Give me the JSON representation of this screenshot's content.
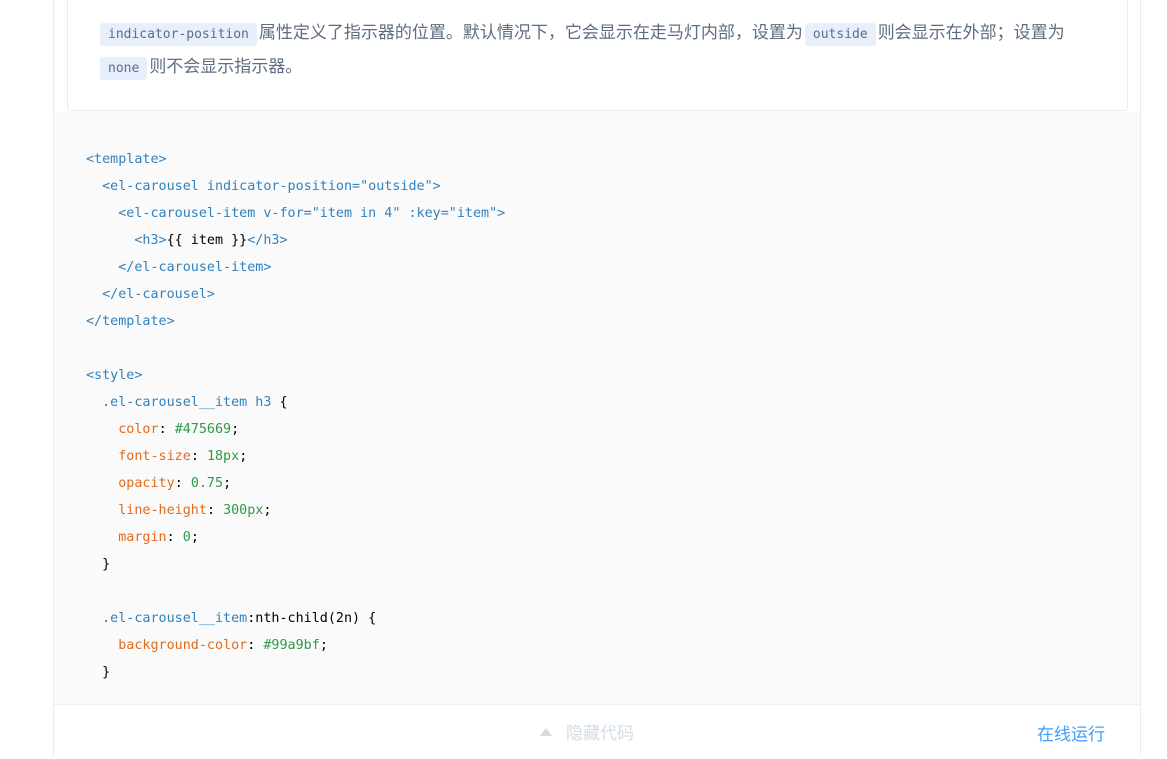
{
  "description": {
    "code_position": "indicator-position",
    "text_1": "属性定义了指示器的位置。默认情况下，它会显示在走马灯内部，设置为",
    "code_outside": "outside",
    "text_2": "则会显示在外部；设置为",
    "code_none": "none",
    "text_3": "则不会显示指示器。"
  },
  "code": {
    "lines": [
      "<template>",
      "  <el-carousel indicator-position=\"outside\">",
      "    <el-carousel-item v-for=\"item in 4\" :key=\"item\">",
      "      <h3>{{ item }}</h3>",
      "    </el-carousel-item>",
      "  </el-carousel>",
      "</template>",
      "",
      "<style>",
      "  .el-carousel__item h3 {",
      "    color: #475669;",
      "    font-size: 18px;",
      "    opacity: 0.75;",
      "    line-height: 300px;",
      "    margin: 0;",
      "  }",
      "",
      "  .el-carousel__item:nth-child(2n) {",
      "    background-color: #99a9bf;",
      "  }"
    ]
  },
  "control": {
    "toggle_label": "隐藏代码",
    "run_label": "在线运行"
  },
  "colors": {
    "accent": "#409eff",
    "tag": "#3182bd",
    "property": "#e06c1c",
    "value": "#2e9a48"
  }
}
